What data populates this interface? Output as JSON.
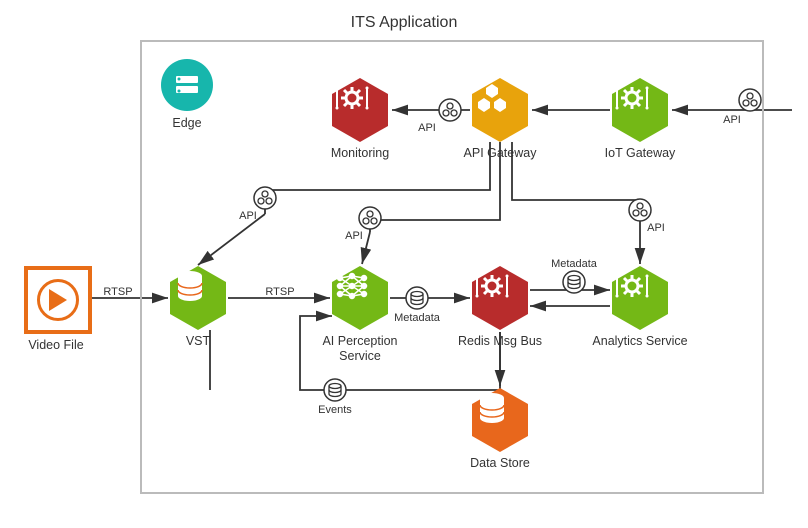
{
  "title": "ITS Application",
  "nodes": {
    "video_file": {
      "label": "Video File"
    },
    "edge": {
      "label": "Edge"
    },
    "monitoring": {
      "label": "Monitoring"
    },
    "api_gateway": {
      "label": "API Gateway"
    },
    "iot_gateway": {
      "label": "IoT Gateway"
    },
    "vst": {
      "label": "VST"
    },
    "ai_perception": {
      "label": "AI Perception Service"
    },
    "redis": {
      "label": "Redis Msg Bus"
    },
    "analytics": {
      "label": "Analytics Service"
    },
    "data_store": {
      "label": "Data Store"
    }
  },
  "edges": {
    "video_to_vst": {
      "label": "RTSP"
    },
    "vst_to_ai": {
      "label": "RTSP"
    },
    "ai_to_redis": {
      "label": "Metadata"
    },
    "redis_to_analytics": {
      "label": "Metadata"
    },
    "redis_to_ai_events": {
      "label": "Events"
    },
    "api_to_monitoring": {
      "label": "API"
    },
    "api_to_vst": {
      "label": "API"
    },
    "api_to_ai": {
      "label": "API"
    },
    "api_to_analytics": {
      "label": "API"
    },
    "ext_to_iot": {
      "label": "API"
    }
  },
  "colors": {
    "green": "#74b816",
    "red": "#b82c2c",
    "orange": "#e8a30c",
    "deeporange": "#e8671c",
    "teal": "#17b6ac",
    "grey": "#bbbbbb"
  }
}
